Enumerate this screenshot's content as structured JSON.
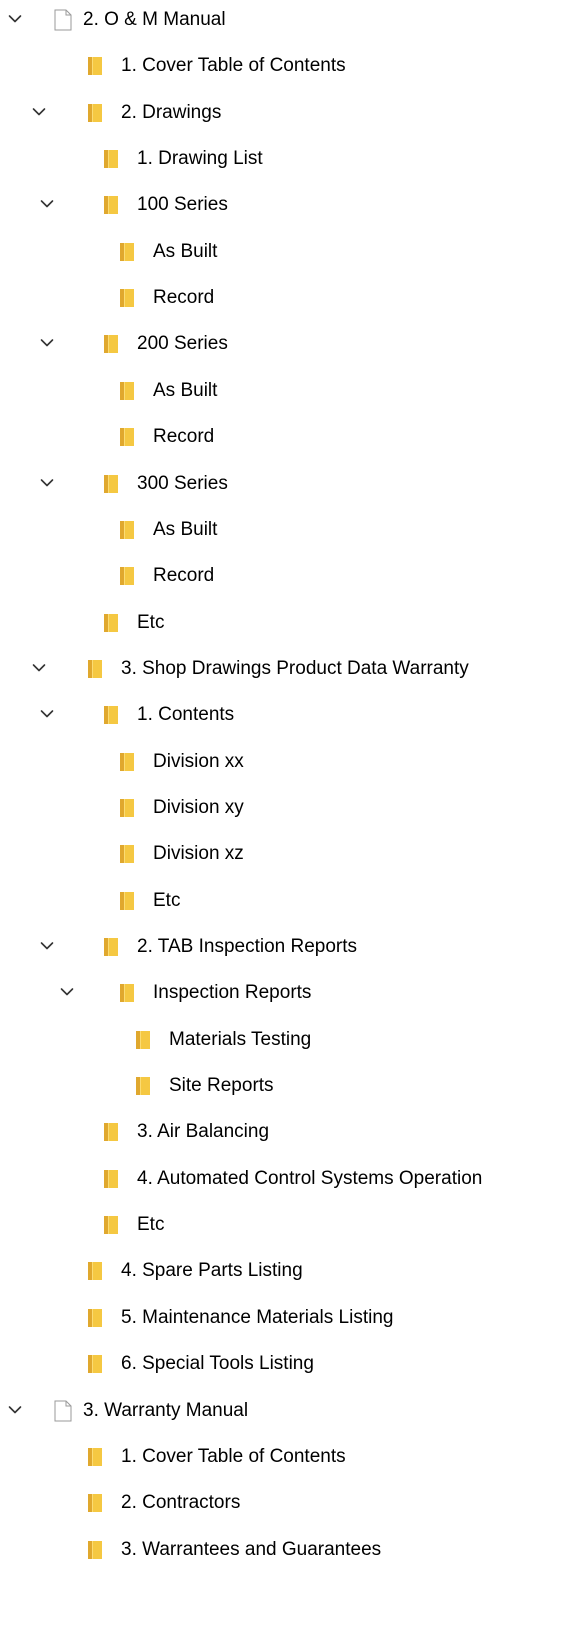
{
  "tree": [
    {
      "label": "2. O & M Manual",
      "type": "file",
      "depth": 0,
      "expanded": true
    },
    {
      "label": "1. Cover Table of Contents",
      "type": "folder",
      "depth": 1,
      "expanded": null
    },
    {
      "label": "2. Drawings",
      "type": "folder",
      "depth": 1,
      "expanded": true
    },
    {
      "label": "1. Drawing List",
      "type": "folder",
      "depth": 2,
      "expanded": null
    },
    {
      "label": "100 Series",
      "type": "folder",
      "depth": 2,
      "expanded": true
    },
    {
      "label": "As Built",
      "type": "folder",
      "depth": 3,
      "expanded": null
    },
    {
      "label": "Record",
      "type": "folder",
      "depth": 3,
      "expanded": null
    },
    {
      "label": "200 Series",
      "type": "folder",
      "depth": 2,
      "expanded": true
    },
    {
      "label": "As Built",
      "type": "folder",
      "depth": 3,
      "expanded": null
    },
    {
      "label": "Record",
      "type": "folder",
      "depth": 3,
      "expanded": null
    },
    {
      "label": "300 Series",
      "type": "folder",
      "depth": 2,
      "expanded": true
    },
    {
      "label": "As Built",
      "type": "folder",
      "depth": 3,
      "expanded": null
    },
    {
      "label": "Record",
      "type": "folder",
      "depth": 3,
      "expanded": null
    },
    {
      "label": "Etc",
      "type": "folder",
      "depth": 2,
      "expanded": null
    },
    {
      "label": "3. Shop Drawings Product Data Warranty",
      "type": "folder",
      "depth": 1,
      "expanded": true
    },
    {
      "label": "1. Contents",
      "type": "folder",
      "depth": 2,
      "expanded": true
    },
    {
      "label": "Division xx",
      "type": "folder",
      "depth": 3,
      "expanded": null
    },
    {
      "label": "Division xy",
      "type": "folder",
      "depth": 3,
      "expanded": null
    },
    {
      "label": "Division xz",
      "type": "folder",
      "depth": 3,
      "expanded": null
    },
    {
      "label": "Etc",
      "type": "folder",
      "depth": 3,
      "expanded": null
    },
    {
      "label": "2. TAB Inspection Reports",
      "type": "folder",
      "depth": 2,
      "expanded": true
    },
    {
      "label": "Inspection Reports",
      "type": "folder",
      "depth": 3,
      "expanded": true
    },
    {
      "label": "Materials Testing",
      "type": "folder",
      "depth": 4,
      "expanded": null
    },
    {
      "label": "Site Reports",
      "type": "folder",
      "depth": 4,
      "expanded": null
    },
    {
      "label": "3. Air Balancing",
      "type": "folder",
      "depth": 2,
      "expanded": null
    },
    {
      "label": "4. Automated Control Systems Operation",
      "type": "folder",
      "depth": 2,
      "expanded": null
    },
    {
      "label": "Etc",
      "type": "folder",
      "depth": 2,
      "expanded": null
    },
    {
      "label": "4. Spare Parts Listing",
      "type": "folder",
      "depth": 1,
      "expanded": null
    },
    {
      "label": "5. Maintenance Materials Listing",
      "type": "folder",
      "depth": 1,
      "expanded": null
    },
    {
      "label": "6. Special Tools Listing",
      "type": "folder",
      "depth": 1,
      "expanded": null
    },
    {
      "label": "3. Warranty Manual",
      "type": "file",
      "depth": 0,
      "expanded": true
    },
    {
      "label": "1. Cover Table of Contents",
      "type": "folder",
      "depth": 1,
      "expanded": null
    },
    {
      "label": "2. Contractors",
      "type": "folder",
      "depth": 1,
      "expanded": null
    },
    {
      "label": "3. Warrantees and Guarantees",
      "type": "folder",
      "depth": 1,
      "expanded": null
    }
  ],
  "icons": {
    "expander": "chevron-down-icon",
    "folder": "folder-icon",
    "file": "document-icon"
  },
  "colors": {
    "folder_body": "#F5C842",
    "folder_shade": "#E0A82E",
    "chevron": "#333333",
    "document_outline": "#9A9A9A"
  }
}
